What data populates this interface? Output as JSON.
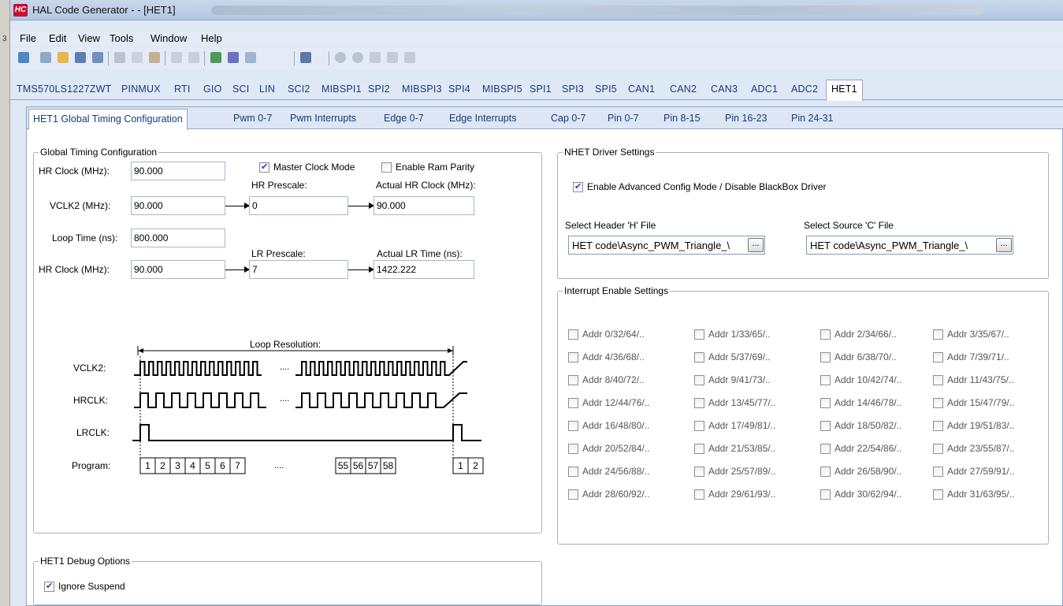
{
  "window": {
    "app_icon": "HC",
    "title": "HAL Code Generator - - [HET1]"
  },
  "left_strip_glyphs": [
    "3"
  ],
  "menu": [
    "File",
    "Edit",
    "View",
    "Tools",
    "Window",
    "Help"
  ],
  "toolbar_icons": [
    "new-icon",
    "open-icon",
    "open-folder-icon",
    "save-icon",
    "save-all-icon",
    "cut-icon",
    "copy-icon",
    "paste-icon",
    "undo-icon",
    "redo-icon",
    "generate-icon",
    "generate-all-icon",
    "view-icon",
    "layers-icon",
    "back-icon",
    "forward-icon",
    "stop-icon",
    "refresh-icon",
    "home-icon"
  ],
  "module_tabs": [
    "TMS570LS1227ZWT",
    "PINMUX",
    "RTI",
    "GIO",
    "SCI",
    "LIN",
    "SCI2",
    "MIBSPI1",
    "SPI2",
    "MIBSPI3",
    "SPI4",
    "MIBSPI5",
    "SPI1",
    "SPI3",
    "SPI5",
    "CAN1",
    "CAN2",
    "CAN3",
    "ADC1",
    "ADC2",
    "HET1"
  ],
  "active_module_tab": "HET1",
  "sub_tabs": [
    "HET1 Global Timing Configuration",
    "Pwm 0-7",
    "Pwm Interrupts",
    "Edge 0-7",
    "Edge Interrupts",
    "Cap 0-7",
    "Pin 0-7",
    "Pin 8-15",
    "Pin 16-23",
    "Pin 24-31"
  ],
  "active_sub_tab": "HET1 Global Timing Configuration",
  "global_timing": {
    "legend": "Global Timing Configuration",
    "hr_clock_label": "HR Clock (MHz):",
    "hr_clock_value": "90.000",
    "master_clock_label": "Master Clock Mode",
    "master_clock_checked": true,
    "ram_parity_label": "Enable Ram Parity",
    "ram_parity_checked": false,
    "vclk2_label": "VCLK2 (MHz):",
    "vclk2_value": "90.000",
    "hr_prescale_label": "HR Prescale:",
    "hr_prescale_value": "0",
    "actual_hr_label": "Actual HR Clock (MHz):",
    "actual_hr_value": "90.000",
    "loop_time_label": "Loop Time (ns):",
    "loop_time_value": "800.000",
    "lr_prescale_label": "LR Prescale:",
    "lr_prescale_value": "7",
    "actual_lr_label": "Actual LR Time (ns):",
    "actual_lr_value": "1422.222",
    "hr_clock2_label": "HR Clock (MHz):",
    "hr_clock2_value": "90.000"
  },
  "diagram": {
    "loop_resolution": "Loop Resolution:",
    "vclk2": "VCLK2:",
    "hrclk": "HRCLK:",
    "lrclk": "LRCLK:",
    "program": "Program:",
    "ellipsis": "....",
    "program_cells": [
      "1",
      "2",
      "3",
      "4",
      "5",
      "6",
      "7"
    ],
    "program_cells_end": [
      "55",
      "56",
      "57",
      "58"
    ],
    "program_cells_next": [
      "1",
      "2"
    ]
  },
  "debug": {
    "legend": "HET1 Debug Options",
    "ignore_suspend_label": "Ignore Suspend",
    "ignore_suspend_checked": true
  },
  "nhet": {
    "legend": "NHET Driver Settings",
    "advanced_label": "Enable Advanced Config Mode / Disable BlackBox Driver",
    "advanced_checked": true,
    "header_label": "Select Header 'H' File",
    "header_value": "HET code\\Async_PWM_Triangle_\\",
    "source_label": "Select Source 'C' File",
    "source_value": "HET code\\Async_PWM_Triangle_\\",
    "browse_label": "..."
  },
  "interrupts": {
    "legend": "Interrupt Enable Settings",
    "items": [
      "Addr 0/32/64/..",
      "Addr 1/33/65/..",
      "Addr 2/34/66/..",
      "Addr 3/35/67/..",
      "Addr 4/36/68/..",
      "Addr 5/37/69/..",
      "Addr 6/38/70/..",
      "Addr 7/39/71/..",
      "Addr 8/40/72/..",
      "Addr 9/41/73/..",
      "Addr 10/42/74/..",
      "Addr 11/43/75/..",
      "Addr 12/44/76/..",
      "Addr 13/45/77/..",
      "Addr 14/46/78/..",
      "Addr 15/47/79/..",
      "Addr 16/48/80/..",
      "Addr 17/49/81/..",
      "Addr 18/50/82/..",
      "Addr 19/51/83/..",
      "Addr 20/52/84/..",
      "Addr 21/53/85/..",
      "Addr 22/54/86/..",
      "Addr 23/55/87/..",
      "Addr 24/56/88/..",
      "Addr 25/57/89/..",
      "Addr 26/58/90/..",
      "Addr 27/59/91/..",
      "Addr 28/60/92/..",
      "Addr 29/61/93/..",
      "Addr 30/62/94/..",
      "Addr 31/63/95/.."
    ]
  },
  "colors": {
    "accent": "#1a3a7a",
    "frame": "#8da6c8",
    "app_icon": "#c8102e"
  }
}
